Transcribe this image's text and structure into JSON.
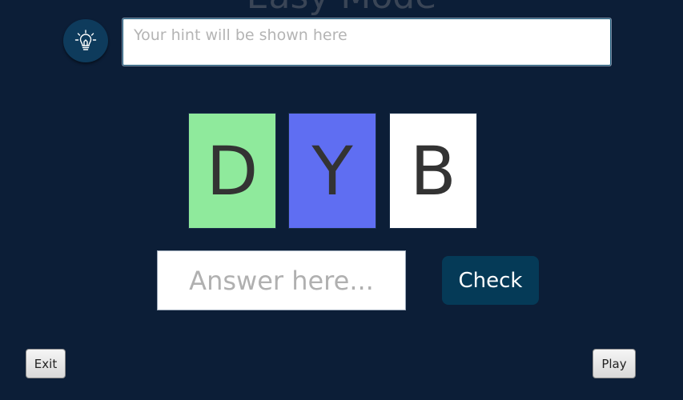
{
  "title": "Easy Mode",
  "hint": {
    "icon": "lightbulb-icon",
    "placeholder": "Your hint will be shown here"
  },
  "tiles": [
    {
      "letter": "D",
      "color": "#8fea9c"
    },
    {
      "letter": "Y",
      "color": "#5f6ef2"
    },
    {
      "letter": "B",
      "color": "#ffffff"
    }
  ],
  "answer": {
    "placeholder": "Answer here..."
  },
  "buttons": {
    "check": "Check",
    "exit": "Exit",
    "play": "Play"
  },
  "colors": {
    "background": "#0c1e37",
    "check_button": "#053a57",
    "hint_button": "#0e3b5c"
  }
}
